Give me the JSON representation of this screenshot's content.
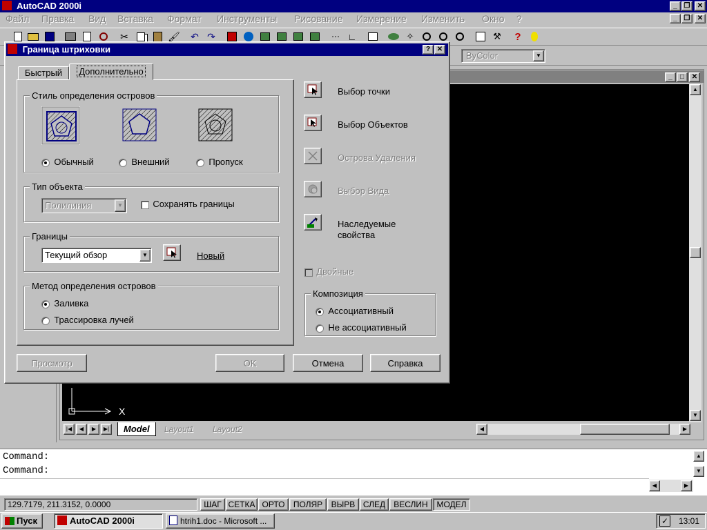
{
  "app": {
    "title": "AutoCAD 2000i"
  },
  "menu": [
    "Файл",
    "Правка",
    "Вид",
    "Вставка",
    "Формат",
    "Инструменты",
    "Рисование",
    "Измерение",
    "Изменить",
    "Окно",
    "?"
  ],
  "props_bar": {
    "color": "ByColor"
  },
  "dialog": {
    "title": "Граница штриховки",
    "tabs": [
      "Быстрый",
      "Дополнительно"
    ],
    "island_style": {
      "title": "Стиль определения островов",
      "options": [
        "Обычный",
        "Внешний",
        "Пропуск"
      ],
      "selected": 0
    },
    "object_type": {
      "title": "Тип объекта",
      "value": "Полилиния",
      "retain_label": "Сохранять границы"
    },
    "boundaries": {
      "title": "Границы",
      "value": "Текущий обзор",
      "new_label": "Новый"
    },
    "island_method": {
      "title": "Метод определения островов",
      "options": [
        "Заливка",
        "Трассировка лучей"
      ],
      "selected": 0
    },
    "actions": [
      "Выбор точки",
      "Выбор Объектов",
      "Острова Удаления",
      "Выбор Вида",
      "Наследуемые свойства"
    ],
    "double_label": "Двойные",
    "composition": {
      "title": "Композиция",
      "options": [
        "Ассоциативный",
        "Не ассоциативный"
      ],
      "selected": 0
    },
    "buttons": {
      "preview": "Просмотр",
      "ok": "OK",
      "cancel": "Отмена",
      "help": "Справка"
    }
  },
  "drawing": {
    "tabs": [
      "Model",
      "Layout1",
      "Layout2"
    ],
    "axis_x": "X"
  },
  "command": {
    "lines": [
      "Command:",
      "Command:"
    ]
  },
  "statusbar": {
    "coords": "129.7179, 211.3152, 0.0000",
    "toggles": [
      "ШАГ",
      "СЕТКА",
      "ОРТО",
      "ПОЛЯР",
      "ВЫРВ",
      "СЛЕД",
      "ВЕСЛИН",
      "МОДЕЛ"
    ]
  },
  "taskbar": {
    "start": "Пуск",
    "items": [
      "AutoCAD 2000i",
      "htrih1.doc - Microsoft ..."
    ],
    "clock": "13:01"
  }
}
